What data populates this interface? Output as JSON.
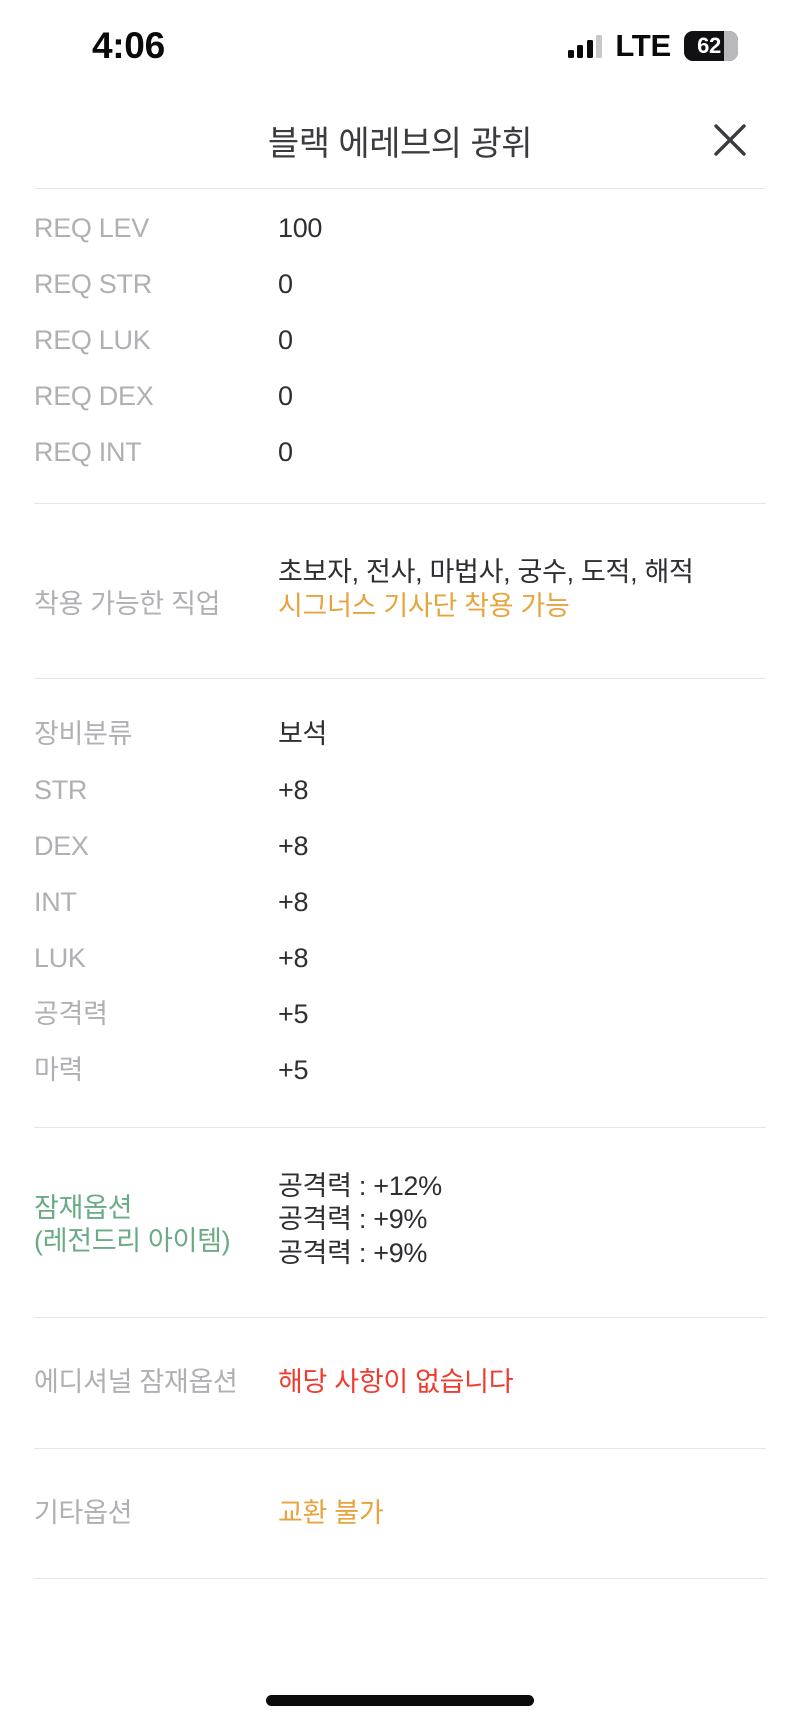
{
  "status_bar": {
    "time": "4:06",
    "carrier": "LTE",
    "battery_level": "62",
    "signal_icon": "cellular-signal-icon",
    "battery_icon": "battery-icon"
  },
  "header": {
    "title": "블랙 에레브의 광휘",
    "close_icon": "close-icon"
  },
  "colors": {
    "orange": "#e8a33d",
    "green": "#6aab86",
    "red": "#f03b2e",
    "label_gray": "#b0b0b4",
    "value_dark": "#2e2e33"
  },
  "requirements": {
    "rows": [
      {
        "label": "REQ LEV",
        "value": "100"
      },
      {
        "label": "REQ STR",
        "value": "0"
      },
      {
        "label": "REQ LUK",
        "value": "0"
      },
      {
        "label": "REQ DEX",
        "value": "0"
      },
      {
        "label": "REQ INT",
        "value": "0"
      }
    ]
  },
  "job": {
    "label": "착용 가능한 직업",
    "classes": "초보자, 전사, 마법사, 궁수, 도적, 해적",
    "special": "시그너스 기사단 착용 가능"
  },
  "equipment": {
    "rows": [
      {
        "label": "장비분류",
        "value": "보석"
      },
      {
        "label": "STR",
        "value": "+8"
      },
      {
        "label": "DEX",
        "value": "+8"
      },
      {
        "label": "INT",
        "value": "+8"
      },
      {
        "label": "LUK",
        "value": "+8"
      },
      {
        "label": "공격력",
        "value": "+5"
      },
      {
        "label": "마력",
        "value": "+5"
      }
    ]
  },
  "potential": {
    "label_line1": "잠재옵션",
    "label_line2": "(레전드리 아이템)",
    "options": [
      "공격력 : +12%",
      "공격력 : +9%",
      "공격력 : +9%"
    ]
  },
  "additional_potential": {
    "label": "에디셔널 잠재옵션",
    "value": "해당 사항이 없습니다"
  },
  "other_options": {
    "label": "기타옵션",
    "value": "교환 불가"
  }
}
